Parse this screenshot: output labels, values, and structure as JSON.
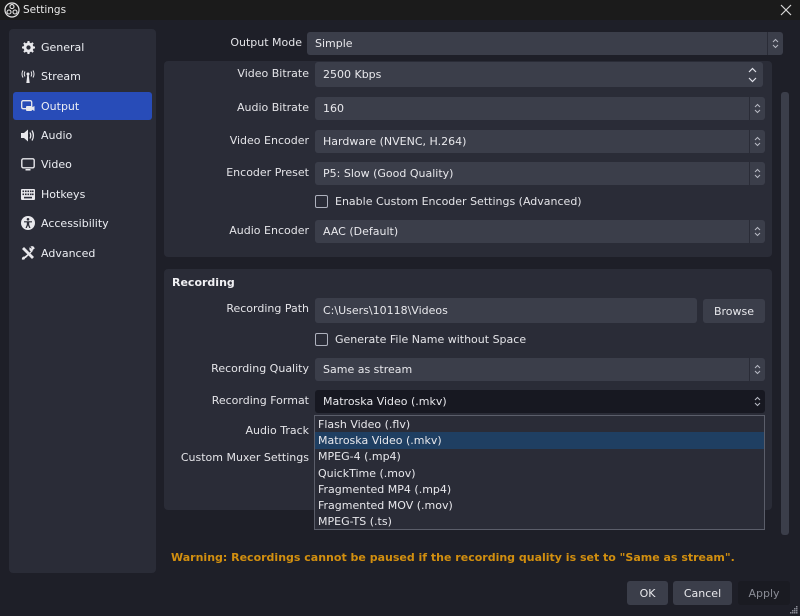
{
  "window": {
    "title": "Settings",
    "icon": "obs-logo-icon",
    "close_icon": "close-icon"
  },
  "sidebar": {
    "items": [
      {
        "label": "General",
        "icon": "gear-icon",
        "active": false
      },
      {
        "label": "Stream",
        "icon": "antenna-icon",
        "active": false
      },
      {
        "label": "Output",
        "icon": "output-icon",
        "active": true
      },
      {
        "label": "Audio",
        "icon": "speaker-icon",
        "active": false
      },
      {
        "label": "Video",
        "icon": "monitor-icon",
        "active": false
      },
      {
        "label": "Hotkeys",
        "icon": "keyboard-icon",
        "active": false
      },
      {
        "label": "Accessibility",
        "icon": "accessibility-icon",
        "active": false
      },
      {
        "label": "Advanced",
        "icon": "tools-icon",
        "active": false
      }
    ]
  },
  "output_mode": {
    "label": "Output Mode",
    "value": "Simple"
  },
  "streaming": {
    "video_bitrate": {
      "label": "Video Bitrate",
      "value": "2500 Kbps"
    },
    "audio_bitrate": {
      "label": "Audio Bitrate",
      "value": "160"
    },
    "video_encoder": {
      "label": "Video Encoder",
      "value": "Hardware (NVENC, H.264)"
    },
    "encoder_preset": {
      "label": "Encoder Preset",
      "value": "P5: Slow (Good Quality)"
    },
    "custom_encoder": {
      "label": "Enable Custom Encoder Settings (Advanced)",
      "checked": false
    },
    "audio_encoder": {
      "label": "Audio Encoder",
      "value": "AAC (Default)"
    }
  },
  "recording": {
    "title": "Recording",
    "path": {
      "label": "Recording Path",
      "value": "C:\\Users\\10118\\Videos",
      "browse_label": "Browse"
    },
    "no_space": {
      "label": "Generate File Name without Space",
      "checked": false
    },
    "quality": {
      "label": "Recording Quality",
      "value": "Same as stream"
    },
    "format": {
      "label": "Recording Format",
      "value": "Matroska Video (.mkv)",
      "options": [
        "Flash Video (.flv)",
        "Matroska Video (.mkv)",
        "MPEG-4 (.mp4)",
        "QuickTime (.mov)",
        "Fragmented MP4 (.mp4)",
        "Fragmented MOV (.mov)",
        "MPEG-TS (.ts)"
      ],
      "selected_index": 1
    },
    "audio_track": {
      "label": "Audio Track"
    },
    "custom_muxer": {
      "label": "Custom Muxer Settings"
    }
  },
  "warning": "Warning: Recordings cannot be paused if the recording quality is set to \"Same as stream\".",
  "buttons": {
    "ok": "OK",
    "cancel": "Cancel",
    "apply": "Apply"
  },
  "colors": {
    "accent": "#284cb8",
    "warning": "#d28f0f",
    "selection": "#1f3f62"
  }
}
